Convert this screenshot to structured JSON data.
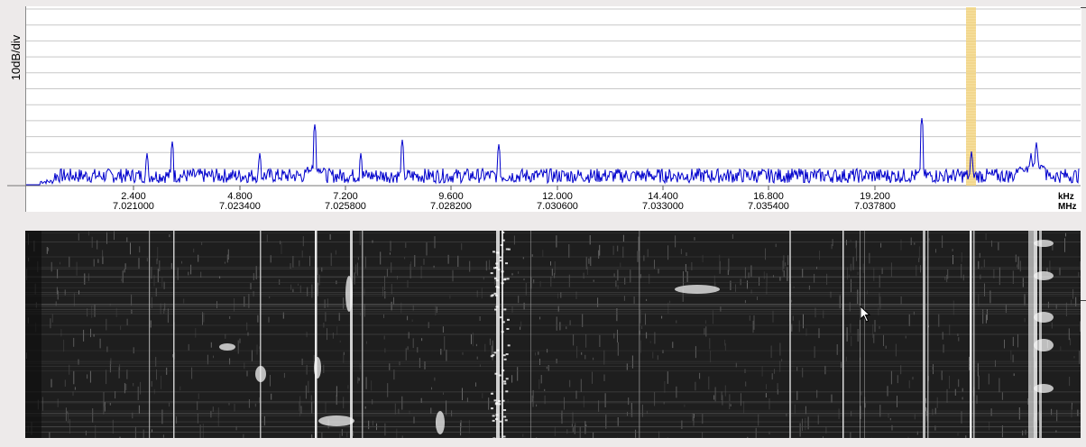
{
  "spectrum": {
    "y_axis_label": "10dB/div",
    "khz_ticks": [
      "2.400",
      "4.800",
      "7.200",
      "9.600",
      "12.000",
      "14.400",
      "16.800",
      "19.200"
    ],
    "mhz_ticks": [
      "7.021000",
      "7.023400",
      "7.025800",
      "7.028200",
      "7.030600",
      "7.033000",
      "7.035400",
      "7.037800"
    ],
    "unit_khz": "kHz",
    "unit_mhz": "MHz",
    "passband_color": "#f5d98c",
    "trace_color": "#0000cc"
  },
  "waterfall": {
    "background_color": "#1e1e1e",
    "icon": "cursor-arrow-icon"
  }
}
